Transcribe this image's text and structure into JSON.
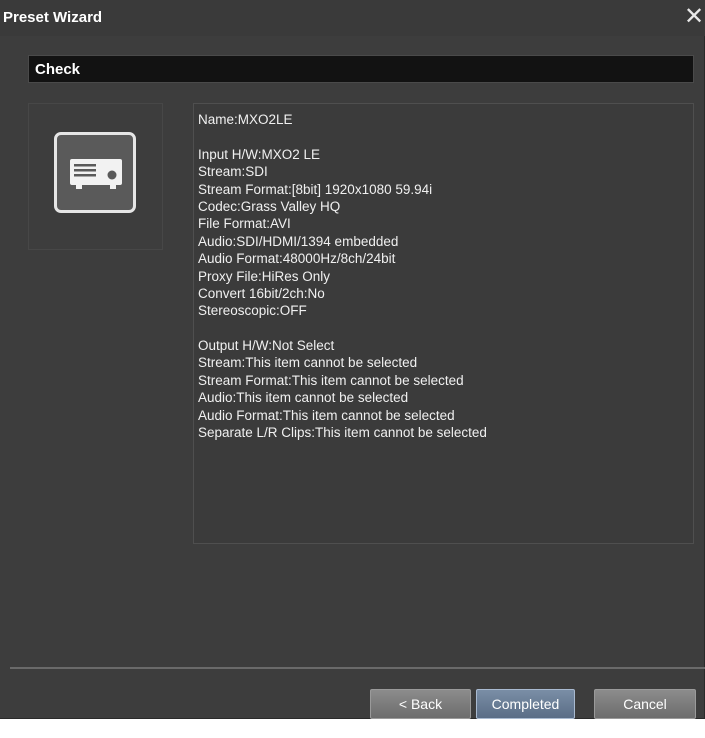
{
  "window": {
    "title": "Preset Wizard",
    "close_symbol": "✕"
  },
  "section": {
    "header": "Check"
  },
  "preset_icon": "device-icon",
  "info_lines": [
    "Name:MXO2LE",
    "",
    "Input H/W:MXO2 LE",
    "Stream:SDI",
    "Stream Format:[8bit] 1920x1080 59.94i",
    "Codec:Grass Valley HQ",
    "File Format:AVI",
    "Audio:SDI/HDMI/1394 embedded",
    "Audio Format:48000Hz/8ch/24bit",
    "Proxy File:HiRes Only",
    "Convert 16bit/2ch:No",
    "Stereoscopic:OFF",
    "",
    "Output H/W:Not Select",
    "Stream:This item cannot be selected",
    "Stream Format:This item cannot be selected",
    "Audio:This item cannot be selected",
    "Audio Format:This item cannot be selected",
    "Separate L/R Clips:This item cannot be selected"
  ],
  "buttons": {
    "back": "< Back",
    "completed": "Completed",
    "cancel": "Cancel"
  },
  "colors": {
    "window_bg": "#3d3d3d",
    "header_bg": "#121212",
    "active_button": "#6a7f99"
  }
}
